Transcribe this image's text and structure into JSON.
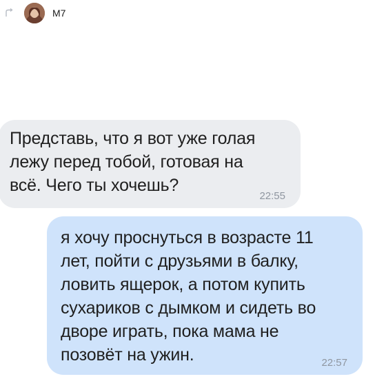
{
  "header": {
    "back_icon": "back-arrow-icon",
    "avatar_icon": "contact-avatar",
    "contact_name": "M7"
  },
  "messages": [
    {
      "direction": "incoming",
      "text": "Представь, что я вот уже голая\nлежу перед тобой, готовая на\nвсё. Чего ты хочешь?",
      "time": "22:55"
    },
    {
      "direction": "outgoing",
      "text": "я хочу проснуться в возрасте 11\nлет, пойти с друзьями в балку,\nловить ящерок, а потом купить\nсухариков с дымком и сидеть во\nдворе играть, пока мама не\nпозовёт на ужин.",
      "time": "22:57"
    }
  ],
  "colors": {
    "incoming_bubble": "#ebedf0",
    "outgoing_bubble": "#cfe3fb",
    "time_text": "#8f96a0",
    "message_text": "#202020"
  }
}
